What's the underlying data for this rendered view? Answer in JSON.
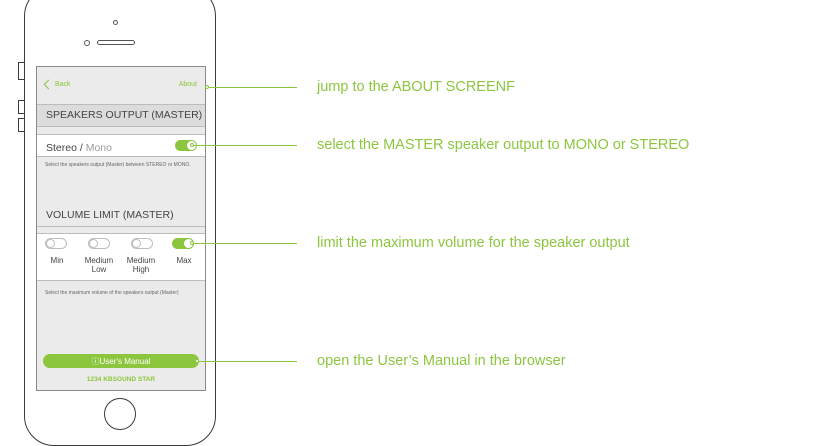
{
  "phone": {
    "nav": {
      "back_label": "Back",
      "about_label": "About"
    },
    "speakers_output": {
      "heading": "SPEAKERS OUTPUT (MASTER)",
      "option_stereo": "Stereo",
      "separator": " / ",
      "option_mono": "Mono",
      "toggle_on": true,
      "description": "Select the speakers output (Master) between STEREO or MONO."
    },
    "volume_limit": {
      "heading": "VOLUME LIMIT (MASTER)",
      "options": [
        {
          "label": "Min",
          "on": false
        },
        {
          "label": "Medium Low",
          "on": false
        },
        {
          "label": "Medium High",
          "on": false
        },
        {
          "label": "Max",
          "on": true
        }
      ],
      "description": "Select the maximum volume of the speakers output (Master)"
    },
    "manual_button": {
      "icon": "info-circle-icon",
      "label": "User's Manual",
      "label_prefix": "ⓘ "
    },
    "device_name": "1234 KBSOUND STAR"
  },
  "annotations": [
    "jump to the ABOUT SCREENF",
    "select the MASTER speaker output to MONO or STEREO",
    "limit the maximum volume for the speaker output",
    "open the User’s Manual in the browser"
  ],
  "colors": {
    "accent": "#8cc63f",
    "screen_bg": "#ebebeb",
    "section_bg": "#dcdcdc",
    "text": "#444444"
  }
}
